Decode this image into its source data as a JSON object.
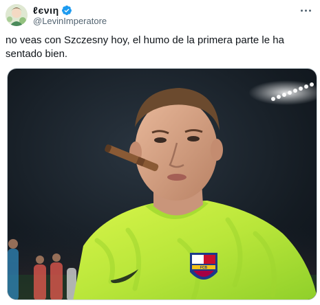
{
  "author": {
    "display_name": "ℓєνιη",
    "handle": "@LevinImperatore",
    "verified": true,
    "verified_color": "#1d9bf0"
  },
  "tweet": {
    "text": "no veas con Szczesny hoy, el humo de la primera parte le ha sentado bien."
  },
  "icons": {
    "more": "more-options-icon",
    "verified": "verified-badge-icon"
  },
  "media": {
    "description_icon": "photo-media",
    "shirt_color": "#c8f03a"
  }
}
